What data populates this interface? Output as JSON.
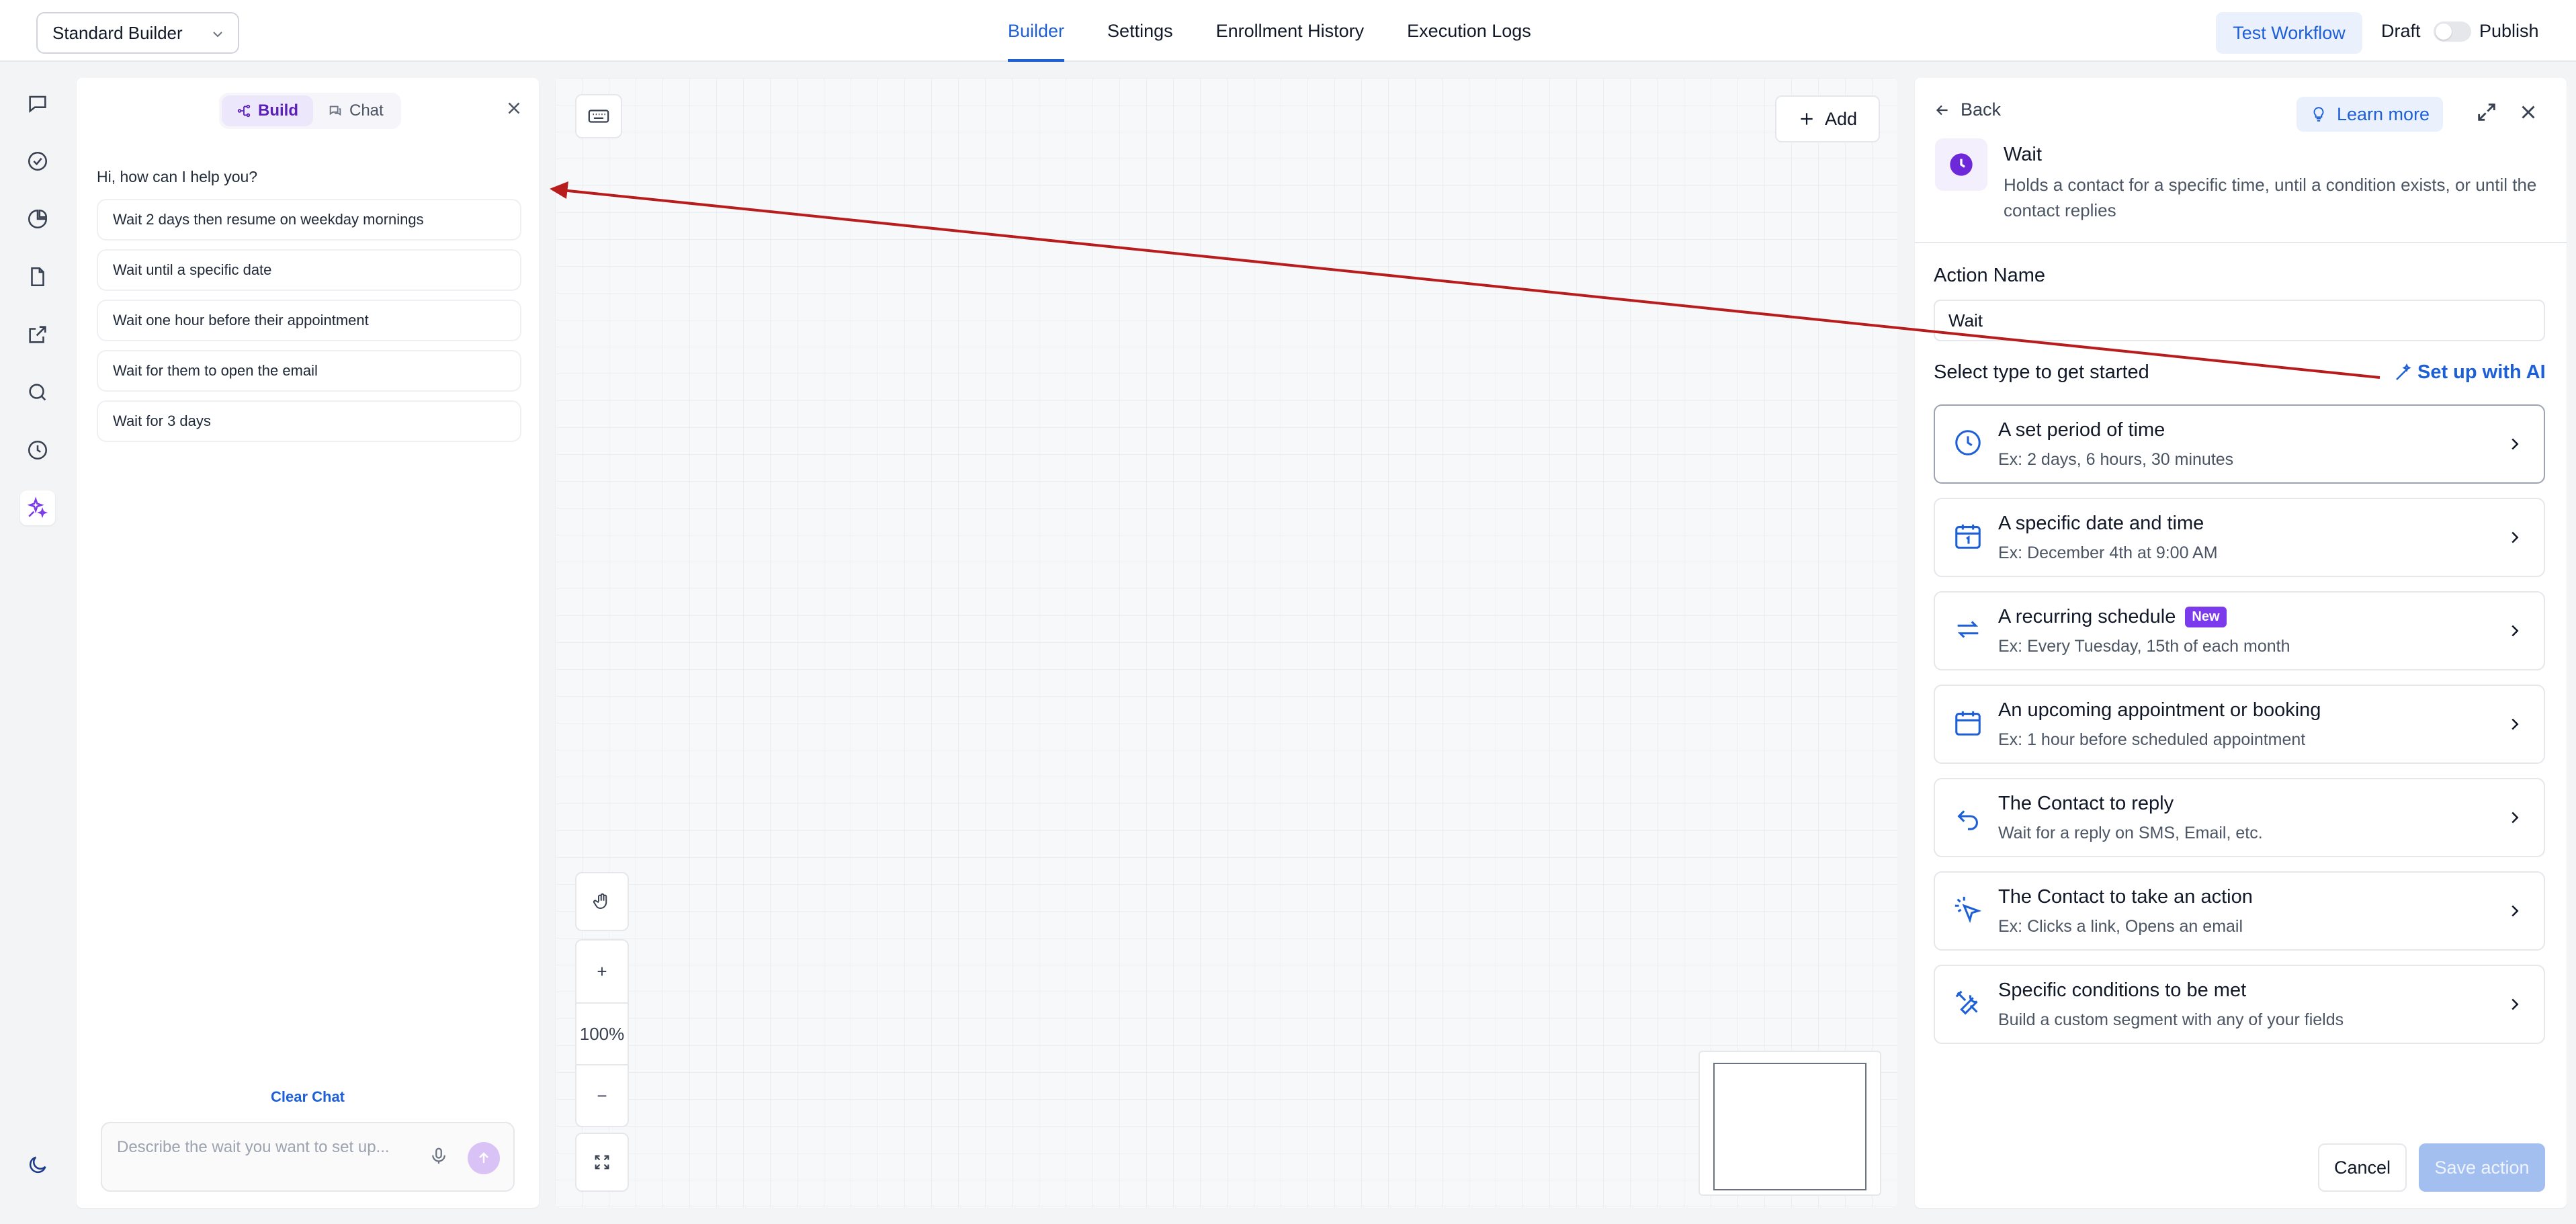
{
  "topbar": {
    "builder_select": "Standard Builder",
    "tabs": [
      {
        "label": "Builder",
        "active": true
      },
      {
        "label": "Settings",
        "active": false
      },
      {
        "label": "Enrollment History",
        "active": false
      },
      {
        "label": "Execution Logs",
        "active": false
      }
    ],
    "test_workflow": "Test Workflow",
    "draft_label": "Draft",
    "publish_label": "Publish",
    "publish_toggle_on": false
  },
  "rail": {
    "icons": [
      "chat-bubble-icon",
      "check-circle-icon",
      "pie-chart-icon",
      "document-icon",
      "external-link-icon",
      "search-icon",
      "history-icon",
      "ai-sparkle-icon"
    ],
    "active": "ai-sparkle-icon",
    "bottom_icon": "moon-icon"
  },
  "ai_panel": {
    "tabs": [
      {
        "label": "Build",
        "active": true
      },
      {
        "label": "Chat",
        "active": false
      }
    ],
    "greeting": "Hi, how can I help you?",
    "suggestions": [
      "Wait 2 days then resume on weekday mornings",
      "Wait until a specific date",
      "Wait one hour before their appointment",
      "Wait for them to open the email",
      "Wait for 3 days"
    ],
    "clear_chat": "Clear Chat",
    "input_placeholder": "Describe the wait you want to set up..."
  },
  "canvas": {
    "add_label": "Add",
    "zoom": "100%",
    "zoom_in": "+",
    "zoom_out": "−"
  },
  "right_panel": {
    "back": "Back",
    "learn_more": "Learn more",
    "title": "Wait",
    "description": "Holds a contact for a specific time, until a condition exists, or until the contact replies",
    "action_name_label": "Action Name",
    "action_name_value": "Wait",
    "select_type_label": "Select type to get started",
    "setup_ai": "Set up with AI",
    "options": [
      {
        "title": "A set period of time",
        "sub": "Ex: 2 days, 6 hours, 30 minutes",
        "icon": "clock-icon",
        "badge": ""
      },
      {
        "title": "A specific date and time",
        "sub": "Ex: December 4th at 9:00 AM",
        "icon": "calendar-date-icon",
        "badge": ""
      },
      {
        "title": "A recurring schedule",
        "sub": "Ex: Every Tuesday, 15th of each month",
        "icon": "repeat-icon",
        "badge": "New"
      },
      {
        "title": "An upcoming appointment or booking",
        "sub": "Ex: 1 hour before scheduled appointment",
        "icon": "calendar-icon",
        "badge": ""
      },
      {
        "title": "The Contact to reply",
        "sub": "Wait for a reply on SMS, Email, etc.",
        "icon": "reply-icon",
        "badge": ""
      },
      {
        "title": "The Contact to take an action",
        "sub": "Ex: Clicks a link, Opens an email",
        "icon": "cursor-click-icon",
        "badge": ""
      },
      {
        "title": "Specific conditions to be met",
        "sub": "Build a custom segment with any of your fields",
        "icon": "tools-icon",
        "badge": ""
      }
    ],
    "cancel": "Cancel",
    "save": "Save action"
  },
  "colors": {
    "accent": "#1d5fd6",
    "ai_purple": "#7c3aed",
    "annotation_arrow": "#b91c1c"
  }
}
